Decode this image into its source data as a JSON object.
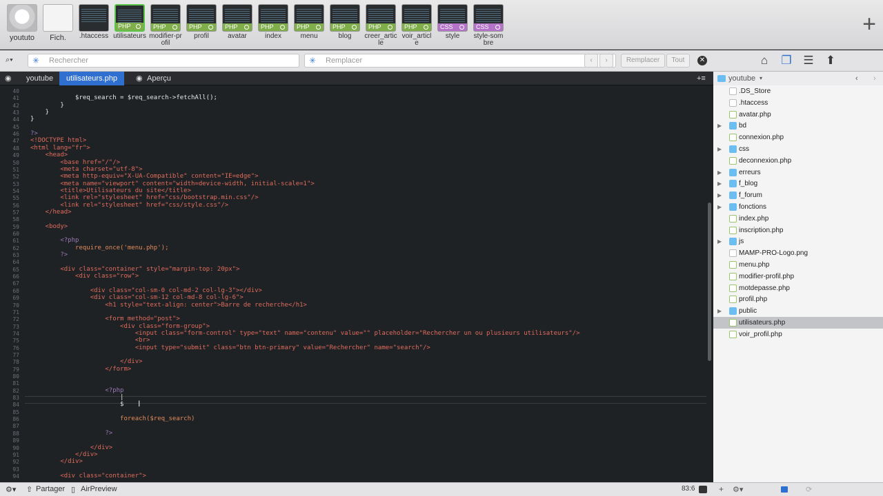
{
  "tabs": [
    {
      "label": "yoututo",
      "type": "big",
      "badge": ""
    },
    {
      "label": "Fich.",
      "type": "big",
      "badge": ""
    },
    {
      "label": ".htaccess",
      "type": "file",
      "badge": ""
    },
    {
      "label": "utilisateurs",
      "type": "file",
      "badge": "PHP"
    },
    {
      "label": "modifier-profil",
      "type": "file",
      "badge": "PHP"
    },
    {
      "label": "profil",
      "type": "file",
      "badge": "PHP"
    },
    {
      "label": "avatar",
      "type": "file",
      "badge": "PHP"
    },
    {
      "label": "index",
      "type": "file",
      "badge": "PHP"
    },
    {
      "label": "menu",
      "type": "file",
      "badge": "PHP"
    },
    {
      "label": "blog",
      "type": "file",
      "badge": "PHP"
    },
    {
      "label": "creer_article",
      "type": "file",
      "badge": "PHP"
    },
    {
      "label": "voir_article",
      "type": "file",
      "badge": "PHP"
    },
    {
      "label": "style",
      "type": "file",
      "badge": "CSS"
    },
    {
      "label": "style-sombre",
      "type": "file",
      "badge": "CSS"
    }
  ],
  "search": {
    "placeholder": "Rechercher",
    "replace_placeholder": "Remplacer",
    "replace_btn": "Remplacer",
    "all_btn": "Tout"
  },
  "path": {
    "project": "youtube",
    "file": "utilisateurs.php",
    "preview": "Aperçu"
  },
  "lines": [
    {
      "n": "40",
      "txt": ""
    },
    {
      "n": "41",
      "txt": "            $req_search = $req_search->fetchAll();"
    },
    {
      "n": "42",
      "txt": "        }"
    },
    {
      "n": "43",
      "txt": "    }"
    },
    {
      "n": "44",
      "txt": "}"
    },
    {
      "n": "45",
      "txt": ""
    },
    {
      "n": "46",
      "txt": "?>"
    },
    {
      "n": "47",
      "txt": "<!DOCTYPE html>"
    },
    {
      "n": "48",
      "txt": "<html lang=\"fr\">"
    },
    {
      "n": "49",
      "txt": "    <head>"
    },
    {
      "n": "50",
      "txt": "        <base href=\"/\"/>"
    },
    {
      "n": "51",
      "txt": "        <meta charset=\"utf-8\">"
    },
    {
      "n": "52",
      "txt": "        <meta http-equiv=\"X-UA-Compatible\" content=\"IE=edge\">"
    },
    {
      "n": "53",
      "txt": "        <meta name=\"viewport\" content=\"width=device-width, initial-scale=1\">"
    },
    {
      "n": "54",
      "txt": "        <title>Utilisateurs du site</title>"
    },
    {
      "n": "55",
      "txt": "        <link rel=\"stylesheet\" href=\"css/bootstrap.min.css\"/>"
    },
    {
      "n": "56",
      "txt": "        <link rel=\"stylesheet\" href=\"css/style.css\"/>"
    },
    {
      "n": "57",
      "txt": "    </head>"
    },
    {
      "n": "58",
      "txt": ""
    },
    {
      "n": "59",
      "txt": "    <body>"
    },
    {
      "n": "60",
      "txt": ""
    },
    {
      "n": "61",
      "txt": "        <?php"
    },
    {
      "n": "62",
      "txt": "            require_once('menu.php');"
    },
    {
      "n": "63",
      "txt": "        ?>"
    },
    {
      "n": "64",
      "txt": ""
    },
    {
      "n": "65",
      "txt": "        <div class=\"container\" style=\"margin-top: 20px\">"
    },
    {
      "n": "66",
      "txt": "            <div class=\"row\">"
    },
    {
      "n": "67",
      "txt": ""
    },
    {
      "n": "68",
      "txt": "                <div class=\"col-sm-0 col-md-2 col-lg-3\"></div>"
    },
    {
      "n": "69",
      "txt": "                <div class=\"col-sm-12 col-md-8 col-lg-6\">"
    },
    {
      "n": "70",
      "txt": "                    <h1 style=\"text-align: center\">Barre de recherche</h1>"
    },
    {
      "n": "71",
      "txt": ""
    },
    {
      "n": "72",
      "txt": "                    <form method=\"post\">"
    },
    {
      "n": "73",
      "txt": "                        <div class=\"form-group\">"
    },
    {
      "n": "74",
      "txt": "                            <input class=\"form-control\" type=\"text\" name=\"contenu\" value=\"\" placeholder=\"Rechercher un ou plusieurs utilisateurs\"/>"
    },
    {
      "n": "75",
      "txt": "                            <br>"
    },
    {
      "n": "76",
      "txt": "                            <input type=\"submit\" class=\"btn btn-primary\" value=\"Rechercher\" name=\"search\"/>"
    },
    {
      "n": "77",
      "txt": ""
    },
    {
      "n": "78",
      "txt": "                        </div>"
    },
    {
      "n": "79",
      "txt": "                    </form>"
    },
    {
      "n": "80",
      "txt": ""
    },
    {
      "n": "81",
      "txt": ""
    },
    {
      "n": "82",
      "txt": "                    <?php"
    },
    {
      "n": "83",
      "txt": "                        |"
    },
    {
      "n": "84",
      "txt": "                        $"
    },
    {
      "n": "85",
      "txt": ""
    },
    {
      "n": "86",
      "txt": "                        foreach($req_search)"
    },
    {
      "n": "87",
      "txt": ""
    },
    {
      "n": "88",
      "txt": "                    ?>"
    },
    {
      "n": "89",
      "txt": ""
    },
    {
      "n": "90",
      "txt": "                </div>"
    },
    {
      "n": "91",
      "txt": "            </div>"
    },
    {
      "n": "92",
      "txt": "        </div>"
    },
    {
      "n": "93",
      "txt": ""
    },
    {
      "n": "94",
      "txt": "        <div class=\"container\">"
    }
  ],
  "bottom": {
    "share": "Partager",
    "airpreview": "AirPreview",
    "cursor": "83:6"
  },
  "panel": {
    "folder": "youtube"
  },
  "files": [
    {
      "name": ".DS_Store",
      "kind": "file",
      "expand": false
    },
    {
      "name": ".htaccess",
      "kind": "file",
      "expand": false
    },
    {
      "name": "avatar.php",
      "kind": "php",
      "expand": false
    },
    {
      "name": "bd",
      "kind": "folder",
      "expand": true
    },
    {
      "name": "connexion.php",
      "kind": "php",
      "expand": false
    },
    {
      "name": "css",
      "kind": "folder",
      "expand": true
    },
    {
      "name": "deconnexion.php",
      "kind": "php",
      "expand": false
    },
    {
      "name": "erreurs",
      "kind": "folder",
      "expand": true
    },
    {
      "name": "f_blog",
      "kind": "folder",
      "expand": true
    },
    {
      "name": "f_forum",
      "kind": "folder",
      "expand": true
    },
    {
      "name": "fonctions",
      "kind": "folder",
      "expand": true
    },
    {
      "name": "index.php",
      "kind": "php",
      "expand": false
    },
    {
      "name": "inscription.php",
      "kind": "php",
      "expand": false
    },
    {
      "name": "js",
      "kind": "folder",
      "expand": true
    },
    {
      "name": "MAMP-PRO-Logo.png",
      "kind": "file",
      "expand": false
    },
    {
      "name": "menu.php",
      "kind": "php",
      "expand": false
    },
    {
      "name": "modifier-profil.php",
      "kind": "php",
      "expand": false
    },
    {
      "name": "motdepasse.php",
      "kind": "php",
      "expand": false
    },
    {
      "name": "profil.php",
      "kind": "php",
      "expand": false
    },
    {
      "name": "public",
      "kind": "folder",
      "expand": true
    },
    {
      "name": "utilisateurs.php",
      "kind": "php",
      "expand": false,
      "selected": true
    },
    {
      "name": "voir_profil.php",
      "kind": "php",
      "expand": false
    }
  ]
}
